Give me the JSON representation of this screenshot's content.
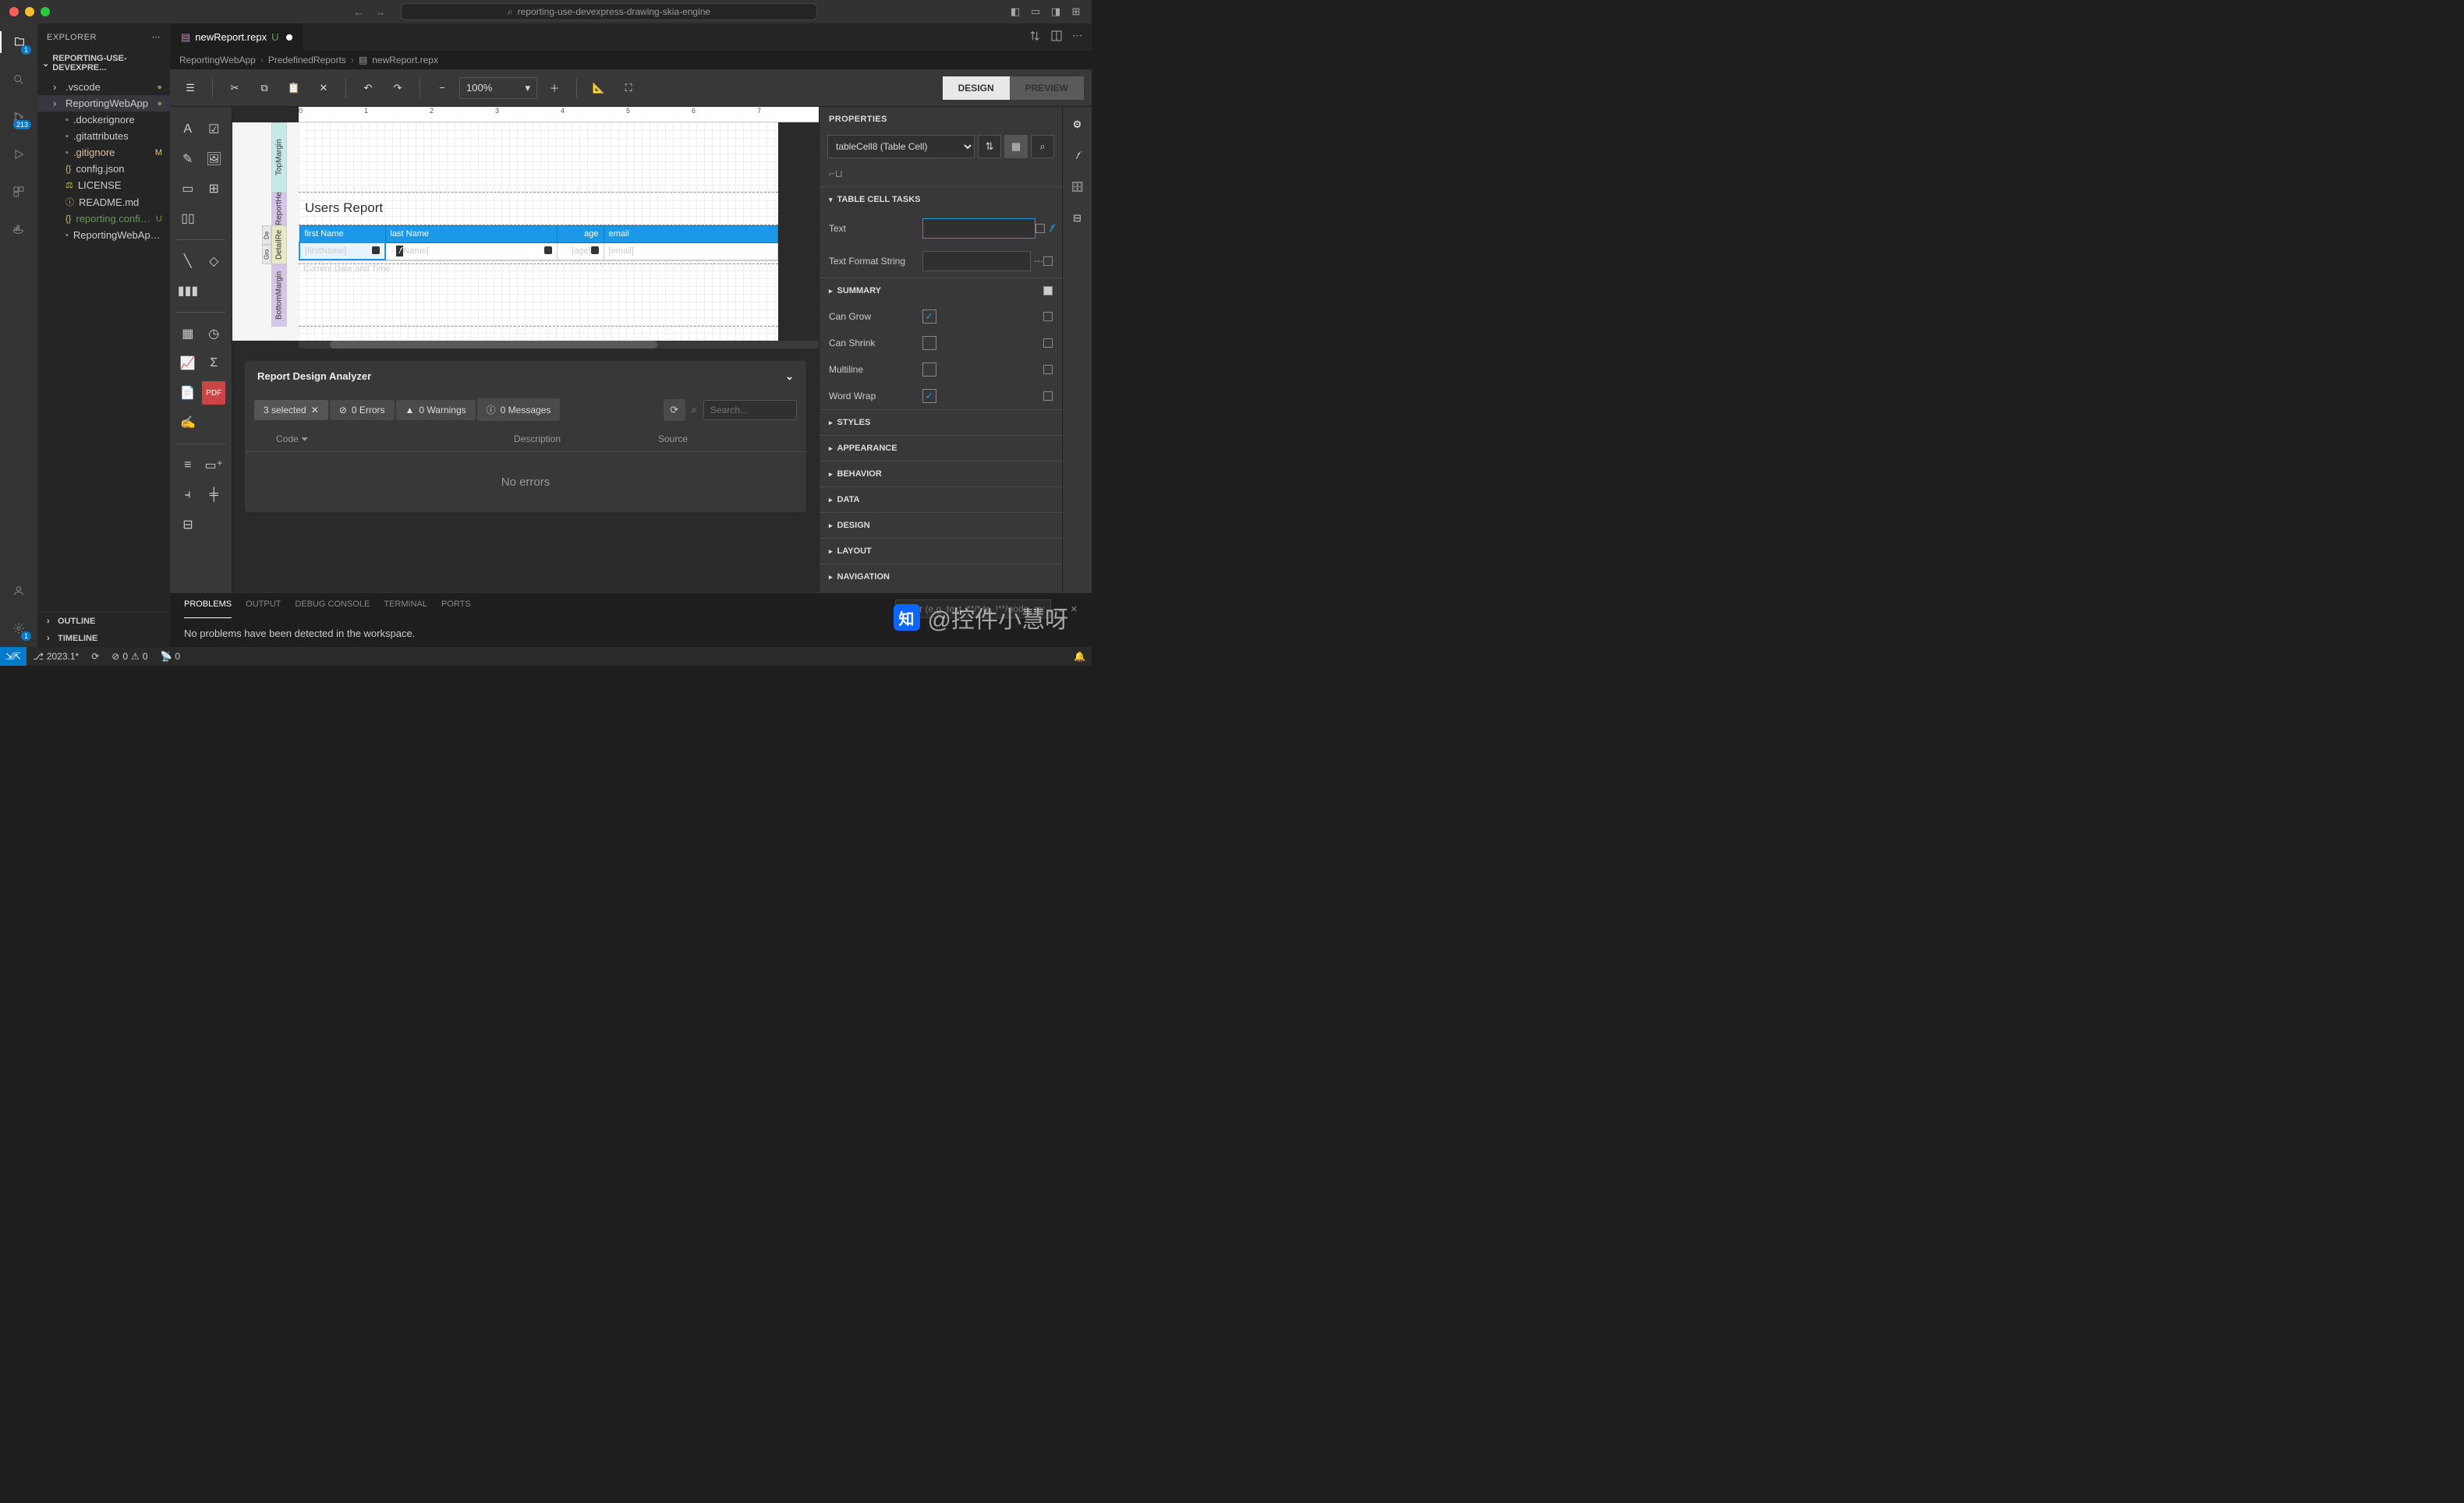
{
  "titlebar": {
    "search": "reporting-use-devexpress-drawing-skia-engine"
  },
  "activity": {
    "explorer_badge": "1",
    "scm_badge": "213"
  },
  "explorer": {
    "title": "EXPLORER",
    "project": "REPORTING-USE-DEVEXPRE...",
    "items": [
      {
        "name": ".vscode",
        "kind": "folder",
        "status": "●",
        "statusClass": ""
      },
      {
        "name": "ReportingWebApp",
        "kind": "folder",
        "sel": true,
        "status": "●",
        "statusClass": ""
      },
      {
        "name": ".dockerignore",
        "kind": "file"
      },
      {
        "name": ".gitattributes",
        "kind": "file"
      },
      {
        "name": ".gitignore",
        "kind": "file",
        "status": "M",
        "statusClass": "m",
        "color": "#e2c08d"
      },
      {
        "name": "config.json",
        "kind": "file",
        "icon": "{}"
      },
      {
        "name": "LICENSE",
        "kind": "file",
        "icon": "⚖"
      },
      {
        "name": "README.md",
        "kind": "file",
        "icon": "ⓘ"
      },
      {
        "name": "reporting.config.json",
        "kind": "file",
        "icon": "{}",
        "status": "U",
        "statusClass": "",
        "color": "#6a9955"
      },
      {
        "name": "ReportingWebApp.sln",
        "kind": "file"
      }
    ],
    "outline": "OUTLINE",
    "timeline": "TIMELINE"
  },
  "tab": {
    "name": "newReport.repx",
    "status": "U"
  },
  "breadcrumb": {
    "a": "ReportingWebApp",
    "b": "PredefinedReports",
    "c": "newReport.repx"
  },
  "toolbar": {
    "zoom": "100%",
    "design": "DESIGN",
    "preview": "PREVIEW"
  },
  "report": {
    "title": "Users Report",
    "bands": {
      "topmargin": "TopMargin",
      "header": "ReportHe",
      "detail": "DetailRe",
      "de": "De",
      "gro": "Gro",
      "botmargin": "BottomMargin"
    },
    "cols": {
      "firstName": "first Name",
      "lastName": "last Name",
      "age": "age",
      "email": "email"
    },
    "cells": {
      "firstName": "[firstName]",
      "lastName": "Name]",
      "age": "[age]",
      "email": "[email]"
    },
    "footer": "Current Date and Time"
  },
  "analyzer": {
    "title": "Report Design Analyzer",
    "selected": "3 selected",
    "errors": "0 Errors",
    "warnings": "0 Warnings",
    "messages": "0 Messages",
    "search_ph": "Search...",
    "cols": {
      "code": "Code",
      "desc": "Description",
      "source": "Source"
    },
    "empty": "No errors"
  },
  "properties": {
    "title": "PROPERTIES",
    "object": "tableCell8 (Table Cell)",
    "sections": {
      "tasks": "TABLE CELL TASKS",
      "summary": "SUMMARY",
      "styles": "STYLES",
      "appearance": "APPEARANCE",
      "behavior": "BEHAVIOR",
      "data": "DATA",
      "design": "DESIGN",
      "layout": "LAYOUT",
      "navigation": "NAVIGATION"
    },
    "rows": {
      "text": "Text",
      "tfs": "Text Format String",
      "cangrow": "Can Grow",
      "canshrink": "Can Shrink",
      "multiline": "Multiline",
      "wordwrap": "Word Wrap"
    }
  },
  "panel": {
    "tabs": {
      "problems": "PROBLEMS",
      "output": "OUTPUT",
      "debug": "DEBUG CONSOLE",
      "terminal": "TERMINAL",
      "ports": "PORTS"
    },
    "msg": "No problems have been detected in the workspace.",
    "filter_ph": "Filter (e.g. text, **/*.ts, !**/node_modules/**)"
  },
  "statusbar": {
    "branch": "2023.1*",
    "sync": "",
    "errors": "0",
    "warnings": "0",
    "ports": "0"
  },
  "watermark": "@控件小慧呀"
}
